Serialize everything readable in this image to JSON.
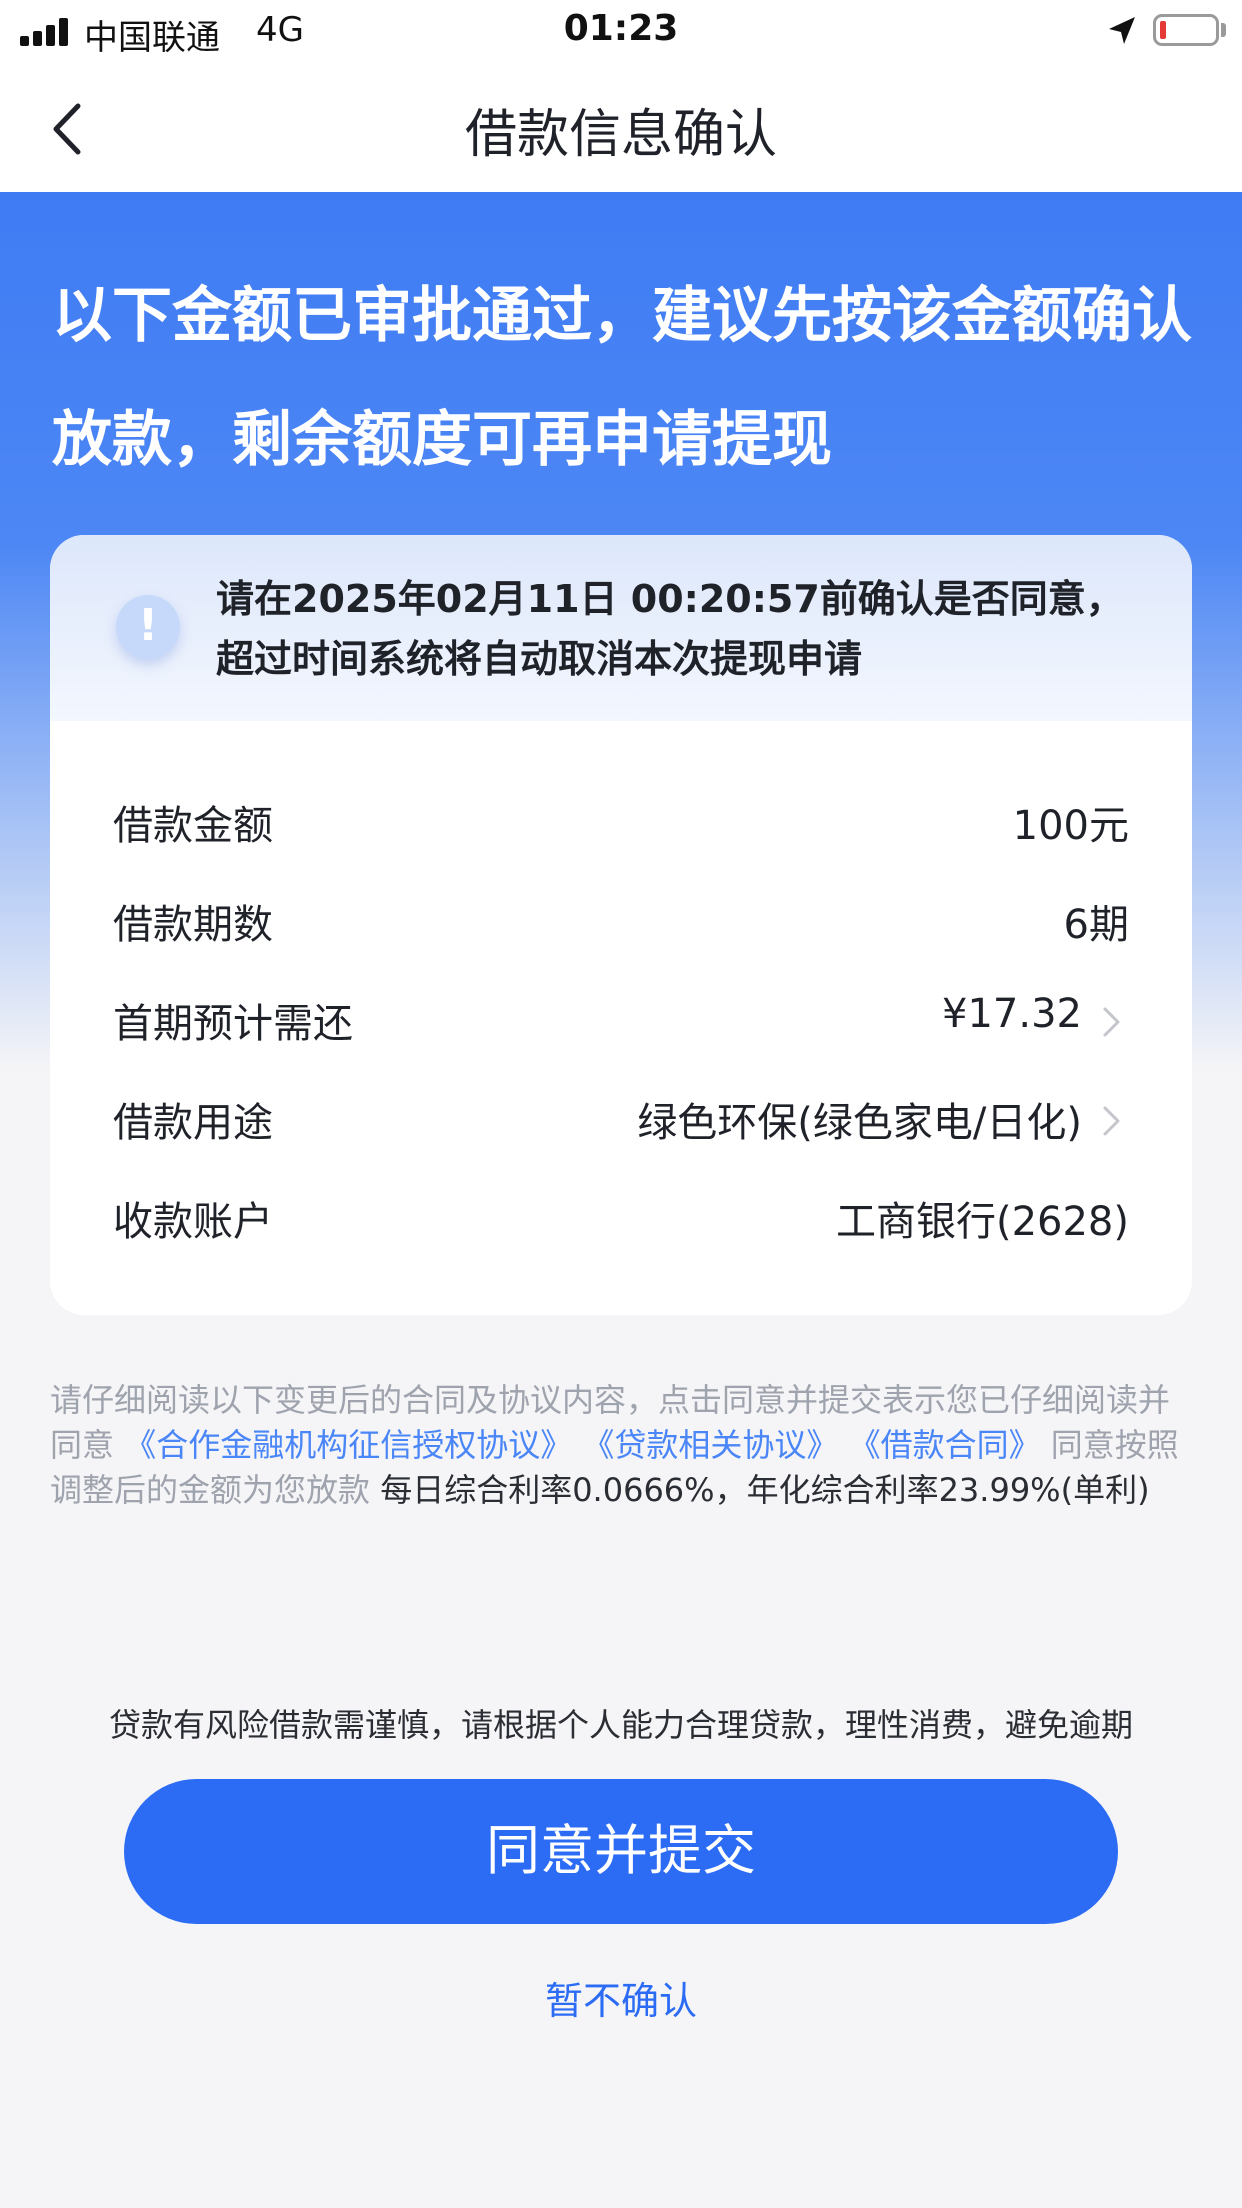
{
  "status_bar": {
    "carrier": "中国联通",
    "network": "4G",
    "time": "01:23",
    "battery_level_fraction": 0.1,
    "battery_color": "#e53935"
  },
  "nav": {
    "title": "借款信息确认",
    "back_icon": "chevron-left-icon"
  },
  "hero": {
    "title": "以下金额已审批通过，建议先按该金额确认放款，剩余额度可再申请提现",
    "gradient_start": "#3f7cf4"
  },
  "notice": {
    "icon": "exclamation-icon",
    "line1": "请在2025年02月11日 00:20:57前确认是否同意，",
    "line2": "超过时间系统将自动取消本次提现申请"
  },
  "details": [
    {
      "label": "借款金额",
      "value": "100元",
      "has_chevron": false
    },
    {
      "label": "借款期数",
      "value": "6期",
      "has_chevron": false
    },
    {
      "label": "首期预计需还",
      "value": "¥17.32",
      "has_chevron": true
    },
    {
      "label": "借款用途",
      "value": "绿色环保(绿色家电/日化)",
      "has_chevron": true
    },
    {
      "label": "收款账户",
      "value": "工商银行(2628)",
      "has_chevron": false
    }
  ],
  "agreement": {
    "intro": "请仔细阅读以下变更后的合同及协议内容，点击同意并提交表示您已仔细阅读并同意",
    "link1": "《合作金融机构征信授权协议》",
    "link2": "《贷款相关协议》",
    "link3": "《借款合同》",
    "consent": "同意按照调整后的金额为您放款",
    "rate_text": "每日综合利率0.0666%，年化综合利率23.99%(单利)"
  },
  "risk_note": "贷款有风险借款需谨慎，请根据个人能力合理贷款，理性消费，避免逾期",
  "actions": {
    "submit_label": "同意并提交",
    "decline_label": "暂不确认",
    "primary_color": "#2c6cf5"
  }
}
